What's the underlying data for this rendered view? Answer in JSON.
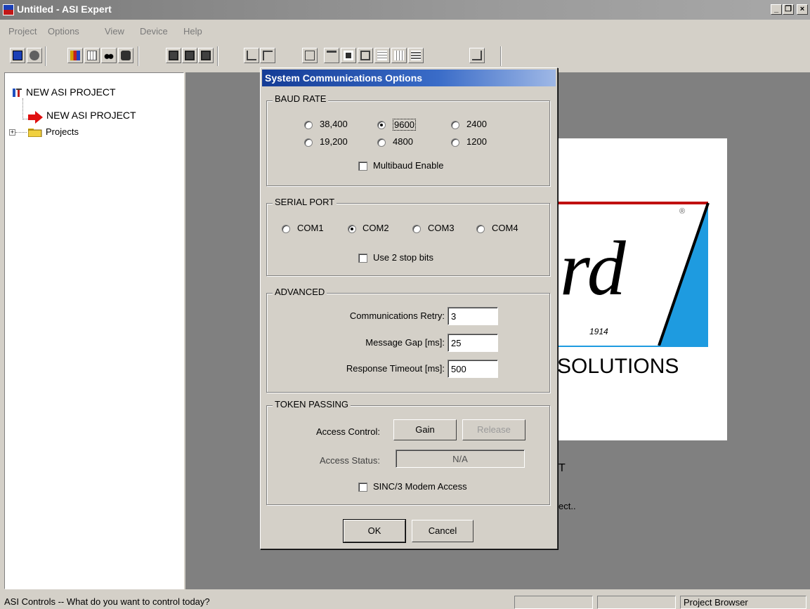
{
  "window": {
    "title": "Untitled - ASI Expert",
    "caption_buttons": [
      "_",
      "&#9633;",
      "×"
    ]
  },
  "menu": [
    "Project",
    "Options",
    "View",
    "Device",
    "Help"
  ],
  "toolbar": {
    "buttons": [
      "new-icon",
      "open-icon",
      "chart-icon",
      "grid-icon",
      "binoculars-icon",
      "stop-icon",
      "save-icon",
      "save-all-icon",
      "save-as-icon",
      "upload-icon",
      "download-icon",
      "tree-icon",
      "tool-icon",
      "panel-icon",
      "window-icon",
      "grid2-icon",
      "table-icon",
      "table2-icon",
      "checklist-icon"
    ]
  },
  "tree": {
    "root": "NEW ASI PROJECT",
    "child": "NEW ASI PROJECT",
    "folder": "Projects",
    "expander": "+"
  },
  "background": {
    "logo_text": "rd",
    "year": "1914",
    "solutions": "SOLUTIONS",
    "reg": "®",
    "partial_t": "T",
    "partial_ect": "ect.."
  },
  "dialog": {
    "title": "System Communications Options",
    "baud": {
      "label": "BAUD RATE",
      "options": [
        "38,400",
        "9600",
        "2400",
        "19,200",
        "4800",
        "1200"
      ],
      "selected": "9600",
      "multibaud_label": "Multibaud Enable",
      "multibaud_checked": false
    },
    "serial": {
      "label": "SERIAL PORT",
      "options": [
        "COM1",
        "COM2",
        "COM3",
        "COM4"
      ],
      "selected": "COM2",
      "stopbits_label": "Use 2 stop bits",
      "stopbits_checked": false
    },
    "advanced": {
      "label": "ADVANCED",
      "retry_label": "Communications Retry:",
      "retry_value": "3",
      "gap_label": "Message Gap [ms]:",
      "gap_value": "25",
      "timeout_label": "Response Timeout [ms]:",
      "timeout_value": "500"
    },
    "token": {
      "label": "TOKEN PASSING",
      "access_control_label": "Access Control:",
      "gain_label": "Gain",
      "release_label": "Release",
      "access_status_label": "Access Status:",
      "access_status_value": "N/A",
      "sinc_label": "SINC/3 Modem Access",
      "sinc_checked": false
    },
    "ok_label": "OK",
    "cancel_label": "Cancel"
  },
  "status": {
    "message": "ASI Controls -- What do you want to control today?",
    "panel1": "",
    "panel2": "",
    "panel3": "Project Browser"
  },
  "colors": {
    "dialog_title": "#143c96",
    "splash_blue": "#1e9be0",
    "red_arrow": "#e01010",
    "desktop_gray": "#808080"
  }
}
